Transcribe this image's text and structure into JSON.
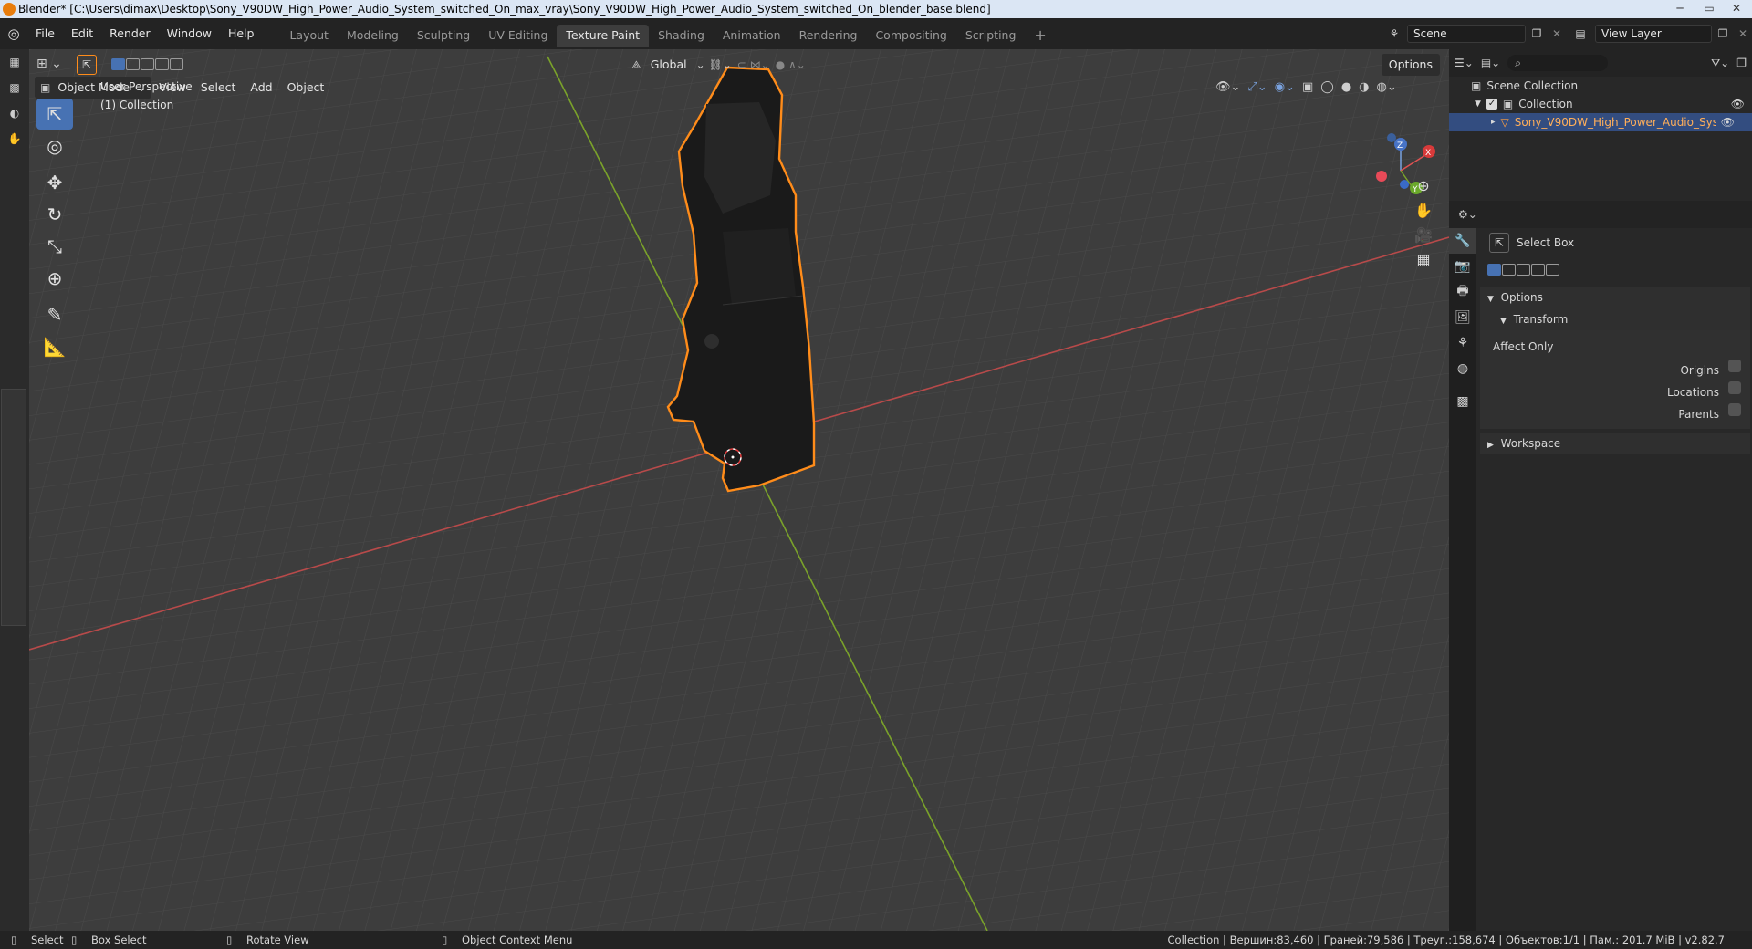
{
  "window": {
    "title": "Blender* [C:\\Users\\dimax\\Desktop\\Sony_V90DW_High_Power_Audio_System_switched_On_max_vray\\Sony_V90DW_High_Power_Audio_System_switched_On_blender_base.blend]",
    "min": "─",
    "max": "▭",
    "close": "✕"
  },
  "menu": [
    "File",
    "Edit",
    "Render",
    "Window",
    "Help"
  ],
  "workspaces": [
    "Layout",
    "Modeling",
    "Sculpting",
    "UV Editing",
    "Texture Paint",
    "Shading",
    "Animation",
    "Rendering",
    "Compositing",
    "Scripting",
    "+"
  ],
  "active_workspace": "Texture Paint",
  "scene": {
    "label": "Scene",
    "view_layer": "View Layer"
  },
  "viewport": {
    "transform_orientation": "Global",
    "mode": "Object Mode",
    "menus": [
      "View",
      "Select",
      "Add",
      "Object"
    ],
    "options": "Options",
    "overlay_line1": "User Perspective",
    "overlay_line2": "(1) Collection",
    "gizmo": {
      "x": "X",
      "y": "Y",
      "z": "Z"
    }
  },
  "outliner": {
    "scene_collection": "Scene Collection",
    "collection": "Collection",
    "object": "Sony_V90DW_High_Power_Audio_System_s"
  },
  "properties": {
    "tool_name": "Select Box",
    "options": "Options",
    "transform": "Transform",
    "affect_only": "Affect Only",
    "origins": "Origins",
    "locations": "Locations",
    "parents": "Parents",
    "workspace": "Workspace"
  },
  "status": {
    "select": "Select",
    "box_select": "Box Select",
    "rotate_view": "Rotate View",
    "context_menu": "Object Context Menu",
    "stats": "Collection | Вершин:83,460 | Граней:79,586 | Треуг.:158,674 | Объектов:1/1 | Пам.: 201.7 MiB | v2.82.7"
  },
  "colors": {
    "accent": "#4772b3",
    "selection_outline": "#ff8c1a",
    "x_axis": "#b84a4a",
    "y_axis": "#7aa22a"
  }
}
